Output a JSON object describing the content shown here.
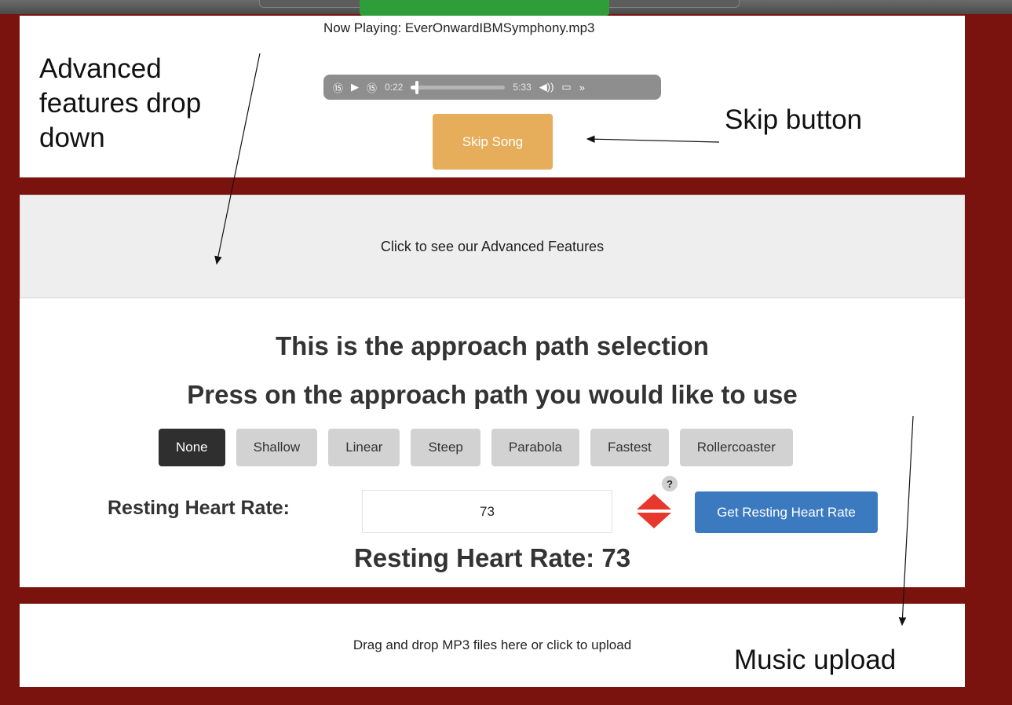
{
  "player": {
    "now_playing": "Now Playing: EverOnwardIBMSymphony.mp3",
    "current_time": "0:22",
    "duration": "5:33",
    "progress": 0.066,
    "skip_label": "Skip Song"
  },
  "advanced": {
    "label": "Click to see our Advanced Features"
  },
  "approach": {
    "title": "This is the approach path selection",
    "subtitle": "Press on the approach path you would like to use",
    "paths": [
      "None",
      "Shallow",
      "Linear",
      "Steep",
      "Parabola",
      "Fastest",
      "Rollercoaster"
    ],
    "selected": "None"
  },
  "heart_rate": {
    "label": "Resting Heart Rate:",
    "input_value": "73",
    "help": "?",
    "get_button": "Get Resting Heart Rate",
    "display": "Resting Heart Rate: 73"
  },
  "upload": {
    "label": "Drag and drop MP3 files here or click to upload"
  },
  "annotations": {
    "advanced": "Advanced features drop down",
    "skip": "Skip button",
    "upload": "Music upload"
  },
  "colors": {
    "background": "#7a130e",
    "skip_button": "#e6ae5b",
    "get_button": "#3c7ac0",
    "stepper": "#e8372c"
  }
}
